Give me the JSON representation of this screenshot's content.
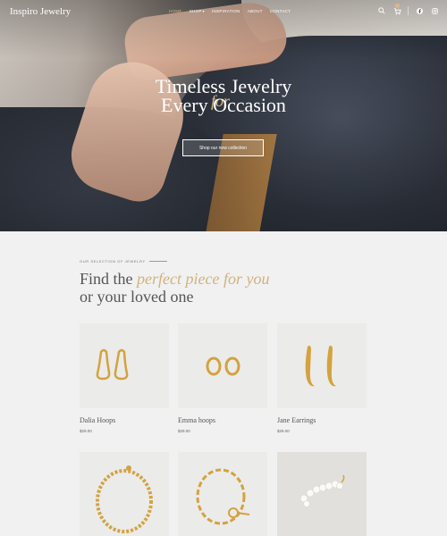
{
  "brand": "Inspiro Jewelry",
  "nav": {
    "home": "Home",
    "shop": "Shop",
    "inspiration": "Inspiration",
    "about": "About",
    "contact": "Contact"
  },
  "hero": {
    "title_line1": "Timeless Jewelry",
    "title_for": "for",
    "title_line2": "Every Occasion",
    "cta": "Shop our new collection"
  },
  "section": {
    "eyebrow": "Our  selection of jewelry",
    "heading_prefix": "Find the ",
    "heading_accent": "perfect piece for you",
    "heading_line2": "or your loved one"
  },
  "products": [
    {
      "name": "Dalia Hoops",
      "price": "$29.00"
    },
    {
      "name": "Emma hoops",
      "price": "$29.00"
    },
    {
      "name": "Jane Earrings",
      "price": "$29.00"
    }
  ],
  "colors": {
    "accent": "#d6b98a",
    "gold": "#d4a23e"
  },
  "icons": [
    "search-icon",
    "cart-icon",
    "facebook-icon",
    "instagram-icon"
  ]
}
